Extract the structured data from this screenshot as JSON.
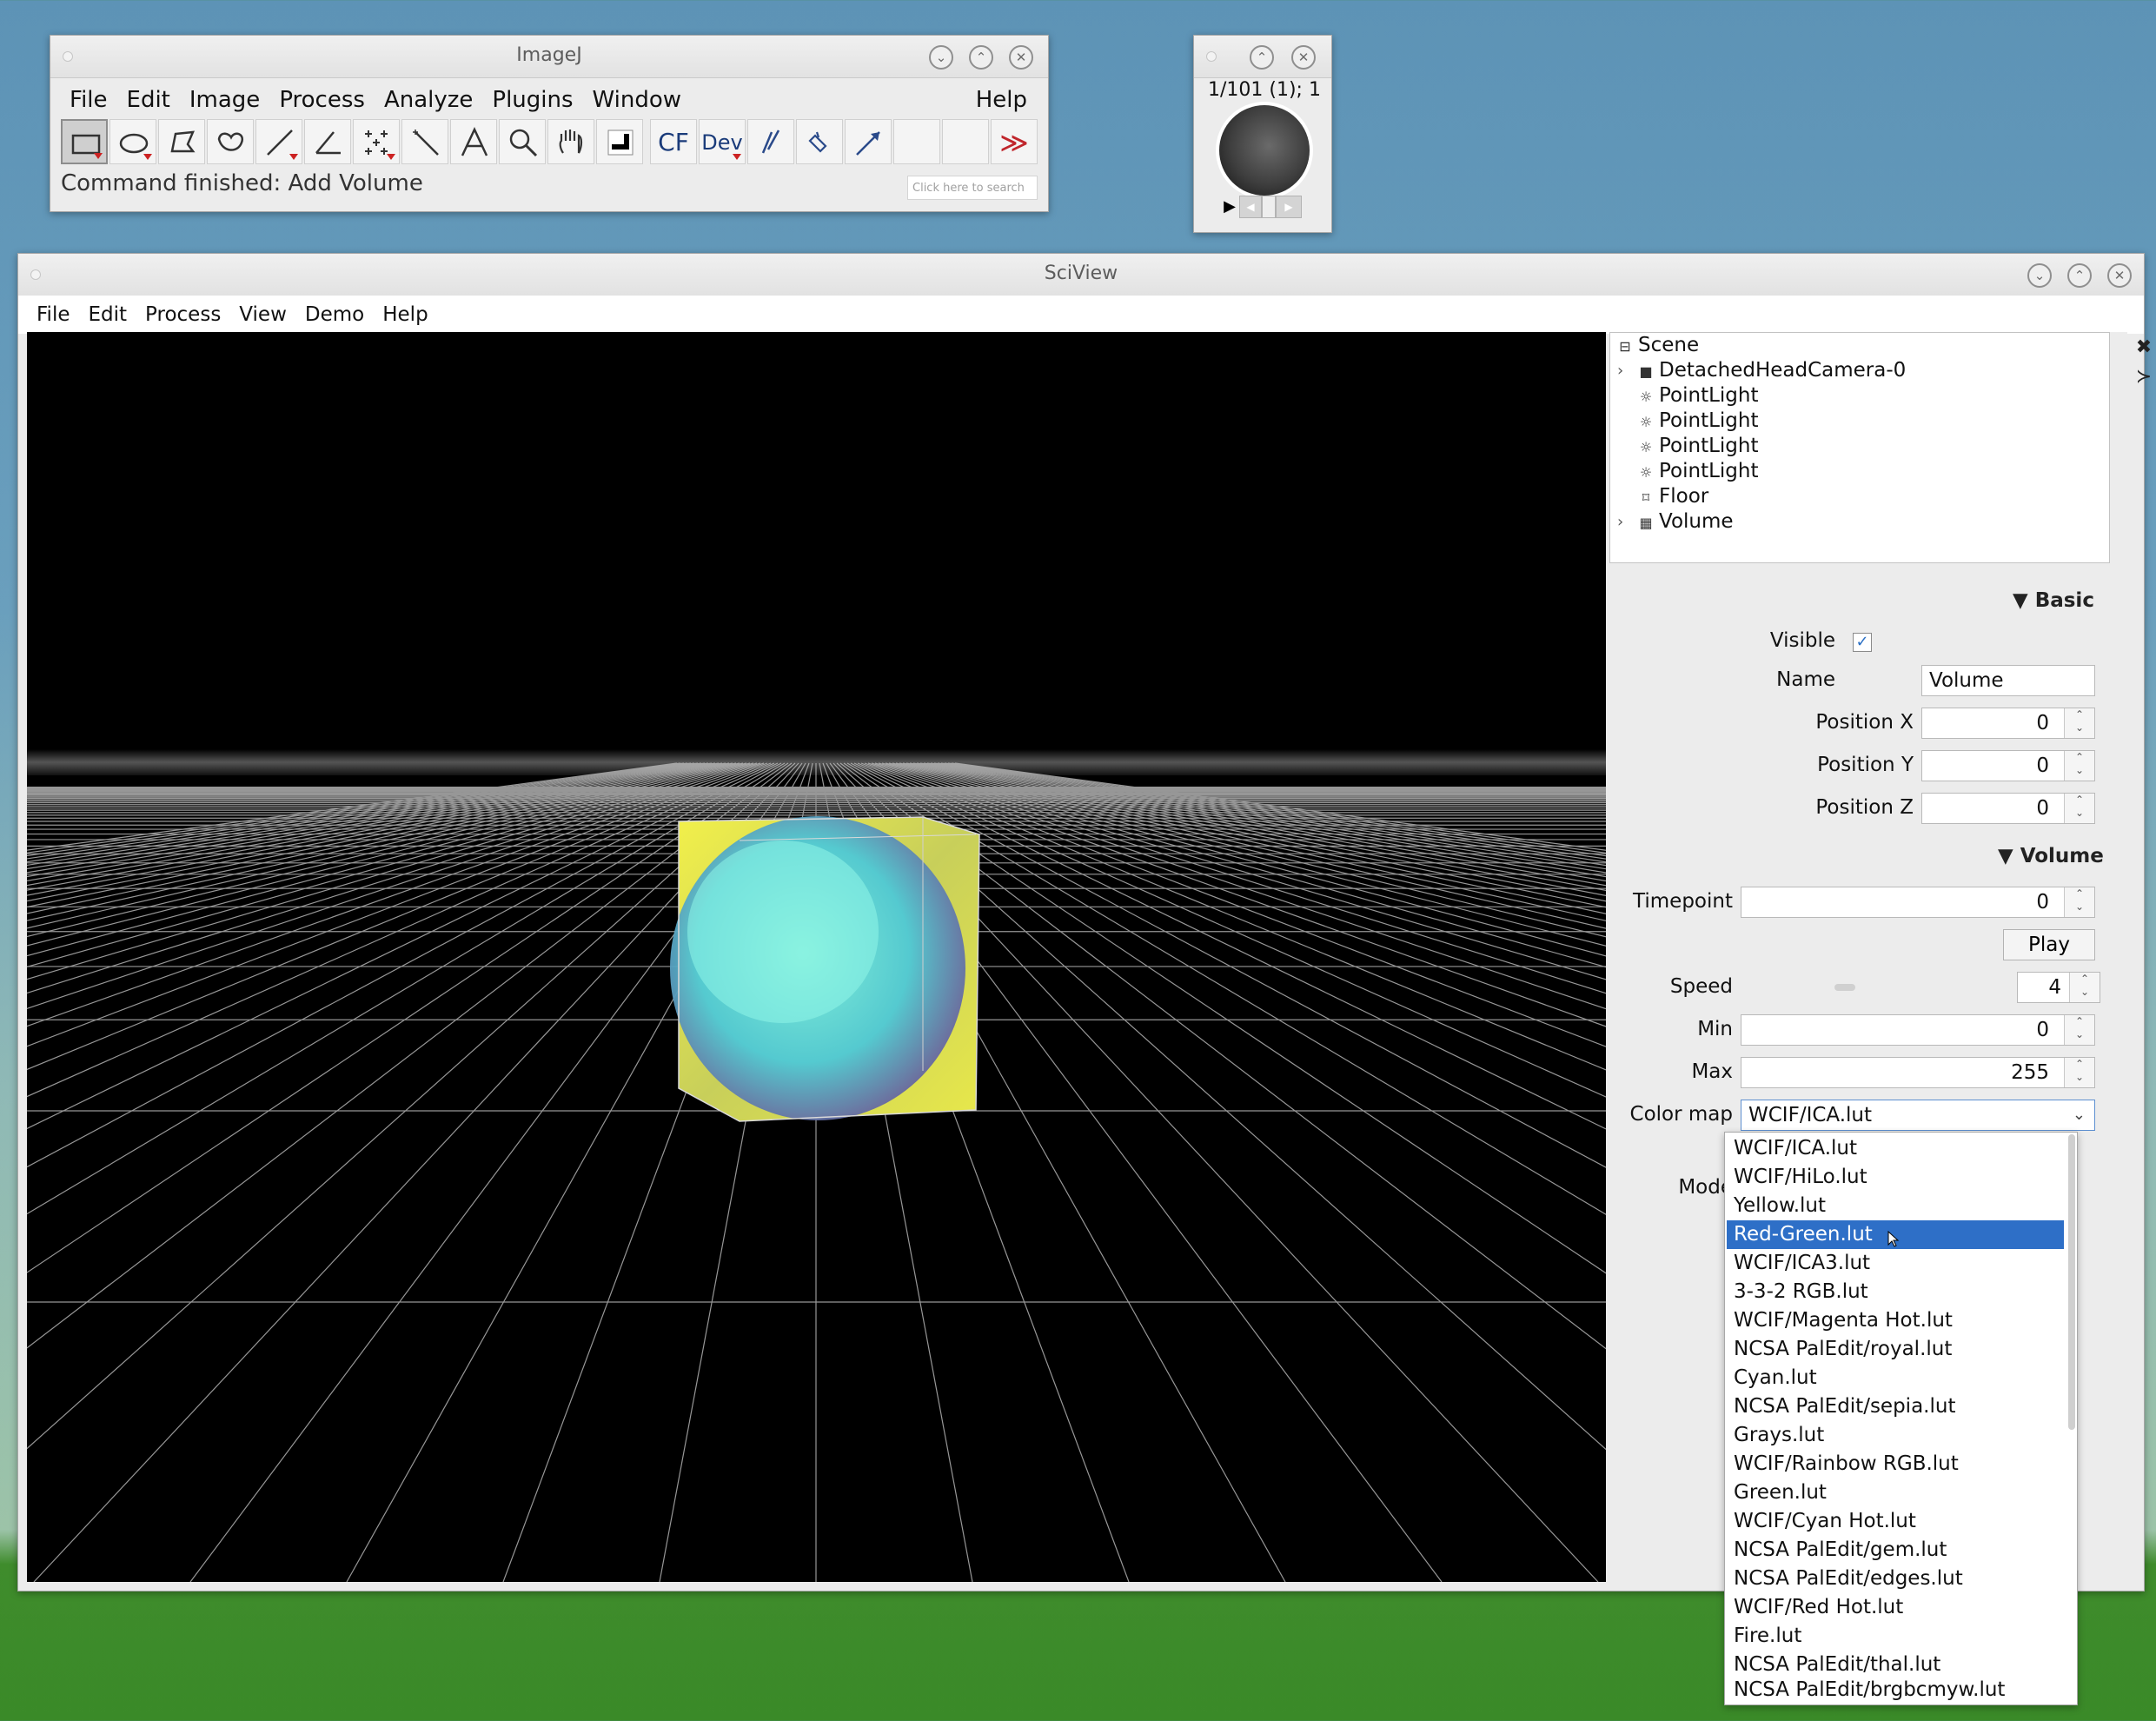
{
  "imagej": {
    "title": "ImageJ",
    "menus": [
      "File",
      "Edit",
      "Image",
      "Process",
      "Analyze",
      "Plugins",
      "Window"
    ],
    "help": "Help",
    "tools": {
      "cf": "CF",
      "dev": "Dev",
      "more": "≫"
    },
    "status": "Command finished: Add Volume",
    "search_placeholder": "Click here to search"
  },
  "stack_window": {
    "label": "1/101 (1); 1"
  },
  "sciview": {
    "title": "SciView",
    "menus": [
      "File",
      "Edit",
      "Process",
      "View",
      "Demo",
      "Help"
    ],
    "tree": [
      {
        "label": "Scene",
        "icon": "collapse-box-icon"
      },
      {
        "label": "DetachedHeadCamera-0",
        "icon": "camera-icon"
      },
      {
        "label": "PointLight",
        "icon": "light-icon"
      },
      {
        "label": "PointLight",
        "icon": "light-icon"
      },
      {
        "label": "PointLight",
        "icon": "light-icon"
      },
      {
        "label": "PointLight",
        "icon": "light-icon"
      },
      {
        "label": "Floor",
        "icon": "mesh-icon"
      },
      {
        "label": "Volume",
        "icon": "volume-icon"
      }
    ],
    "basic": {
      "header": "▼ Basic",
      "visible_label": "Visible",
      "visible": "✓",
      "name_label": "Name",
      "name_value": "Volume",
      "px_label": "Position X",
      "px_value": "0",
      "py_label": "Position Y",
      "py_value": "0",
      "pz_label": "Position Z",
      "pz_value": "0"
    },
    "volume": {
      "header": "▼ Volume",
      "timepoint_label": "Timepoint",
      "timepoint_value": "0",
      "play_label": "Play",
      "speed_label": "Speed",
      "speed_value": "4",
      "min_label": "Min",
      "min_value": "0",
      "max_label": "Max",
      "max_value": "255",
      "colormap_label": "Color map",
      "colormap_value": "WCIF/ICA.lut",
      "mode_label": "Mode"
    },
    "colormap_options": [
      "WCIF/ICA.lut",
      "WCIF/HiLo.lut",
      "Yellow.lut",
      "Red-Green.lut",
      "WCIF/ICA3.lut",
      "3-3-2 RGB.lut",
      "WCIF/Magenta Hot.lut",
      "NCSA PalEdit/royal.lut",
      "Cyan.lut",
      "NCSA PalEdit/sepia.lut",
      "Grays.lut",
      "WCIF/Rainbow RGB.lut",
      "Green.lut",
      "WCIF/Cyan Hot.lut",
      "NCSA PalEdit/gem.lut",
      "NCSA PalEdit/edges.lut",
      "WCIF/Red Hot.lut",
      "Fire.lut",
      "NCSA PalEdit/thal.lut",
      "NCSA PalEdit/brgbcmyw.lut"
    ],
    "highlighted_option": "Red-Green.lut",
    "colors": {
      "highlight": "#2e6fc7",
      "viewport_bg": "#000000"
    }
  }
}
